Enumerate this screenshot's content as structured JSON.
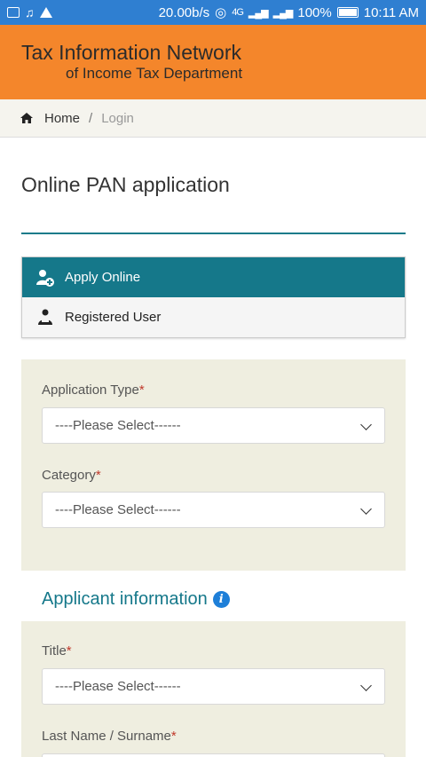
{
  "status_bar": {
    "speed": "20.00b/s",
    "network": "4G",
    "battery": "100%",
    "time": "10:11 AM"
  },
  "header": {
    "title_line1": "Tax Information Network",
    "title_line2": "of Income Tax Department",
    "background_color": "#f4862b"
  },
  "breadcrumb": {
    "home": "Home",
    "separator": "/",
    "current": "Login"
  },
  "page": {
    "title": "Online PAN application"
  },
  "tabs": [
    {
      "label": "Apply Online",
      "icon": "add-user-icon",
      "active": true
    },
    {
      "label": "Registered User",
      "icon": "registered-user-icon",
      "active": false
    }
  ],
  "form": {
    "application_type": {
      "label": "Application Type",
      "required": "*",
      "value": "----Please Select------"
    },
    "category": {
      "label": "Category",
      "required": "*",
      "value": "----Please Select------"
    }
  },
  "applicant_info": {
    "heading": "Applicant information",
    "info_icon": "i",
    "title": {
      "label": "Title",
      "required": "*",
      "value": "----Please Select------"
    },
    "last_name": {
      "label": "Last Name / Surname",
      "required": "*"
    }
  },
  "colors": {
    "accent": "#15788a",
    "panel_bg": "#efeee0",
    "status_bar": "#2f7fd1"
  }
}
